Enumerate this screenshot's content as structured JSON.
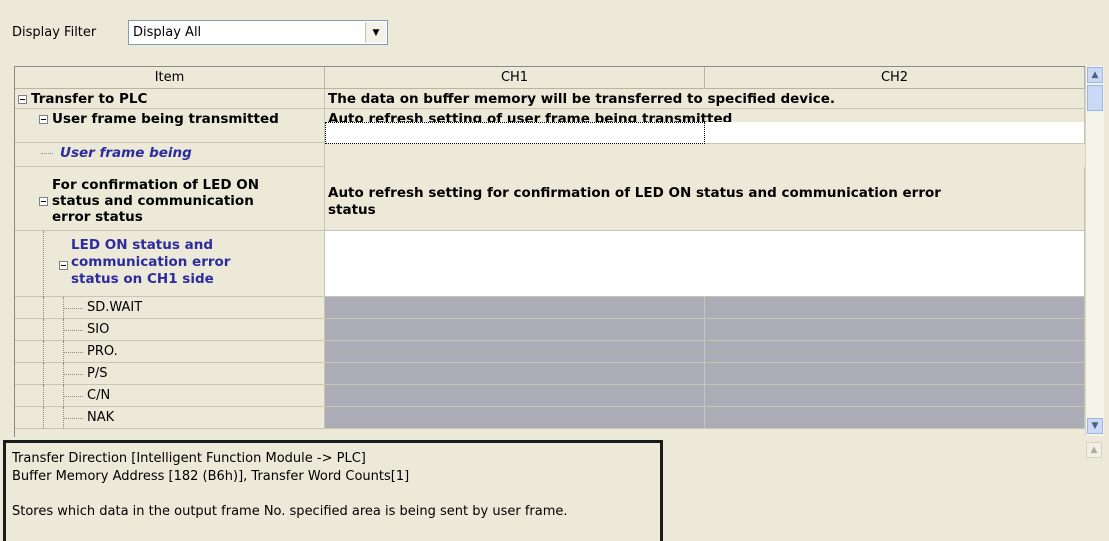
{
  "filter": {
    "label": "Display Filter",
    "value": "Display All"
  },
  "columns": {
    "item": "Item",
    "ch1": "CH1",
    "ch2": "CH2"
  },
  "rows": {
    "transfer_to_plc": {
      "label": "Transfer to PLC",
      "desc": "The data on buffer memory will be transferred to specified device."
    },
    "user_frame_tx": {
      "label": "User frame being transmitted",
      "desc": "Auto refresh setting of user frame being transmitted"
    },
    "user_frame_being": {
      "label": "User frame being"
    },
    "led_confirm": {
      "label_l1": "For confirmation of LED ON",
      "label_l2": "status and communication",
      "label_l3": "error status",
      "desc_l1": "Auto refresh setting for confirmation of LED ON status and communication error",
      "desc_l2": "status"
    },
    "led_ch1": {
      "label_l1": "LED ON status and",
      "label_l2": "communication error",
      "label_l3": "status on CH1 side"
    },
    "leaves": [
      "SD.WAIT",
      "SIO",
      "PRO.",
      "P/S",
      "C/N",
      "NAK"
    ]
  },
  "info": {
    "line1": "Transfer Direction [Intelligent Function Module -> PLC]",
    "line2": "Buffer Memory Address [182 (B6h)], Transfer Word Counts[1]",
    "line3": "Stores which data in the output frame No. specified area is being sent by user frame."
  }
}
